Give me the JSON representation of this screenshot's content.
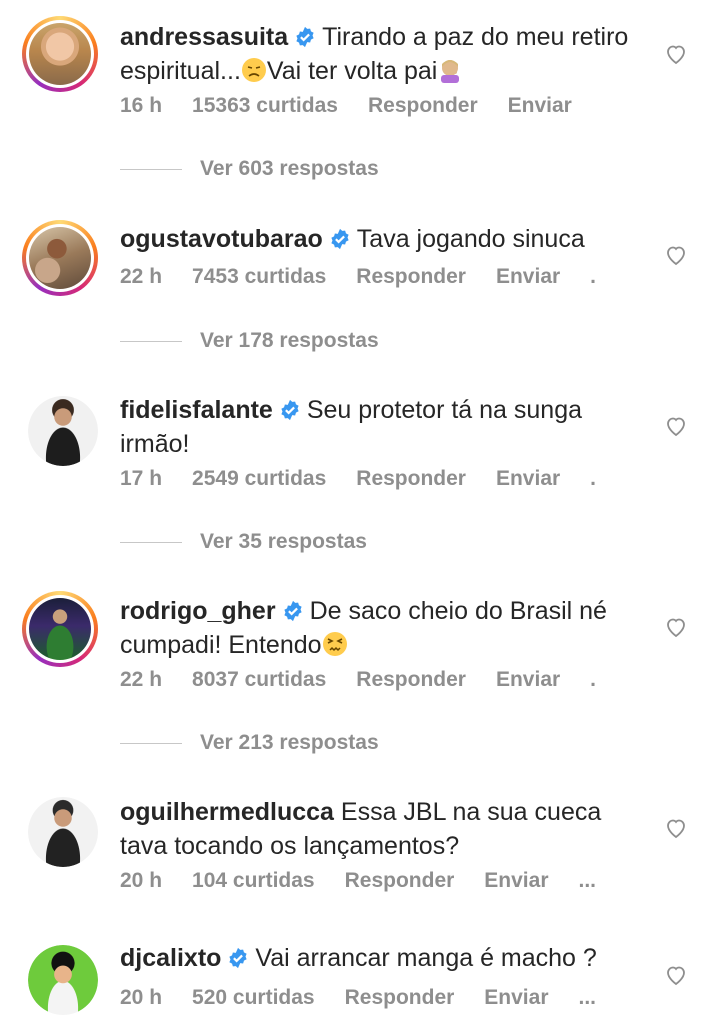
{
  "comments": [
    {
      "username": "andressasuita",
      "verified": true,
      "text": "Tirando a paz do meu retiro espiritual...",
      "text_after": "Vai ter volta pai",
      "time": "16 h",
      "likes": "15363 curtidas",
      "reply_label": "Responder",
      "send_label": "Enviar",
      "more_label": "",
      "view_replies": "Ver 603 respostas"
    },
    {
      "username": "ogustavotubarao",
      "verified": true,
      "text": "Tava jogando sinuca",
      "time": "22 h",
      "likes": "7453 curtidas",
      "reply_label": "Responder",
      "send_label": "Enviar",
      "more_label": ".",
      "view_replies": "Ver 178 respostas"
    },
    {
      "username": "fidelisfalante",
      "verified": true,
      "text": "Seu protetor tá na sunga irmão!",
      "time": "17 h",
      "likes": "2549 curtidas",
      "reply_label": "Responder",
      "send_label": "Enviar",
      "more_label": ".",
      "view_replies": "Ver 35 respostas"
    },
    {
      "username": "rodrigo_gher",
      "verified": true,
      "text": "De saco cheio do Brasil né cumpadi! Entendo",
      "time": "22 h",
      "likes": "8037 curtidas",
      "reply_label": "Responder",
      "send_label": "Enviar",
      "more_label": ".",
      "view_replies": "Ver 213 respostas"
    },
    {
      "username": "oguilhermedlucca",
      "verified": false,
      "text": "Essa JBL na sua cueca tava tocando os lançamentos?",
      "time": "20 h",
      "likes": "104 curtidas",
      "reply_label": "Responder",
      "send_label": "Enviar",
      "more_label": "..."
    },
    {
      "username": "djcalixto",
      "verified": true,
      "text": "Vai arrancar manga é macho ?",
      "time": "20 h",
      "likes": "520 curtidas",
      "reply_label": "Responder",
      "send_label": "Enviar",
      "more_label": "..."
    }
  ],
  "colors": {
    "verified_blue": "#3897f0",
    "meta_gray": "#8e8e8e",
    "text": "#262626"
  }
}
